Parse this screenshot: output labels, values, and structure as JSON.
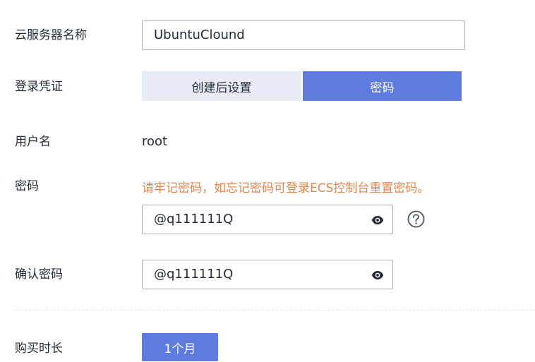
{
  "server_name": {
    "label": "云服务器名称",
    "value": "UbuntuClound"
  },
  "login_credential": {
    "label": "登录凭证",
    "options": [
      "创建后设置",
      "密码"
    ],
    "selected": "密码"
  },
  "username": {
    "label": "用户名",
    "value": "root"
  },
  "password": {
    "label": "密码",
    "warning": "请牢记密码，如忘记密码可登录ECS控制台重置密码。",
    "value": "@q111111Q",
    "reveal_icon": "eye-icon",
    "help_icon": "question-circle-icon"
  },
  "confirm_password": {
    "label": "确认密码",
    "value": "@q111111Q",
    "reveal_icon": "eye-icon"
  },
  "purchase_duration": {
    "label": "购买时长",
    "option": "1个月"
  },
  "colors": {
    "accent": "#5e7ce0",
    "segment_inactive": "#e8ecf7",
    "warning": "#e68548",
    "text": "#252b3a",
    "border": "#adb0b8"
  }
}
